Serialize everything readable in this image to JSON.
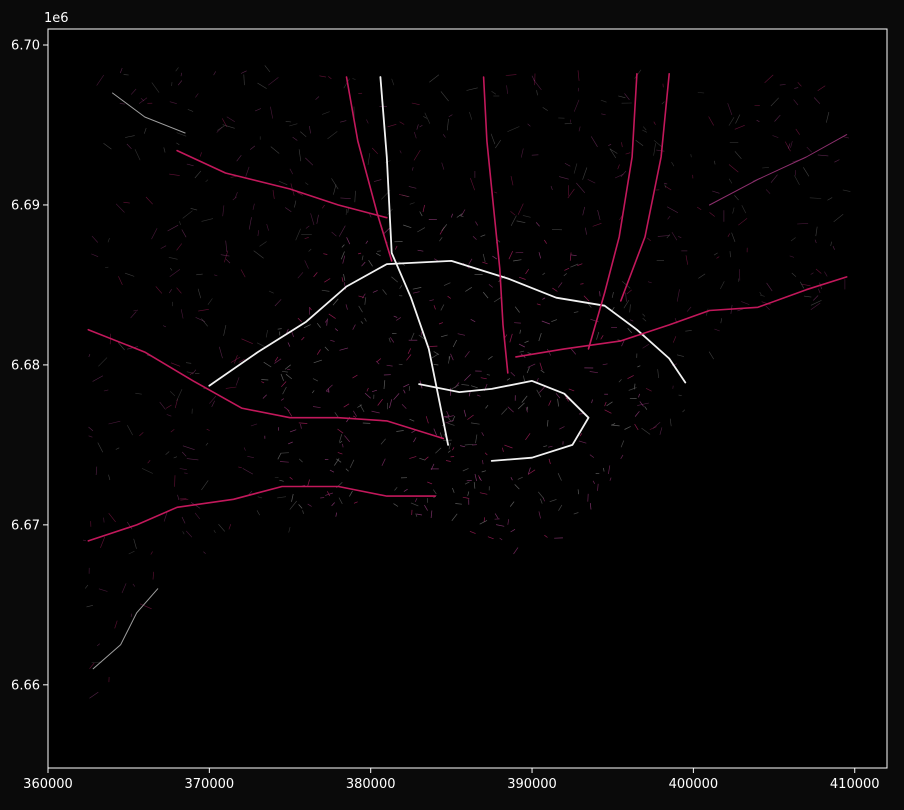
{
  "chart_data": {
    "type": "map",
    "title": "",
    "xlabel": "",
    "ylabel": "",
    "y_offset_label": "1e6",
    "xlim": [
      360000,
      412000
    ],
    "ylim": [
      6654800,
      6701000
    ],
    "x_ticks": [
      {
        "value": 360000,
        "label": "360000"
      },
      {
        "value": 370000,
        "label": "370000"
      },
      {
        "value": 380000,
        "label": "380000"
      },
      {
        "value": 390000,
        "label": "390000"
      },
      {
        "value": 400000,
        "label": "400000"
      },
      {
        "value": 410000,
        "label": "410000"
      }
    ],
    "y_ticks": [
      {
        "value": 6660000,
        "label": "6.66"
      },
      {
        "value": 6670000,
        "label": "6.67"
      },
      {
        "value": 6680000,
        "label": "6.68"
      },
      {
        "value": 6690000,
        "label": "6.69"
      },
      {
        "value": 6700000,
        "label": "6.70"
      }
    ],
    "grid": false,
    "colors": {
      "background": "#000000",
      "figure_background": "#0a0a0a",
      "axes_frame": "#ffffff",
      "road_high": "#c2185b",
      "road_mid": "#8e2f6e",
      "road_low": "#9e9e9e",
      "road_bright": "#f2f2f2"
    },
    "major_roads": [
      {
        "name": "",
        "color": "road_bright",
        "points": [
          [
            370000,
            6678700
          ],
          [
            373000,
            6680800
          ],
          [
            376000,
            6682700
          ],
          [
            378500,
            6684900
          ],
          [
            381000,
            6686300
          ],
          [
            385000,
            6686500
          ],
          [
            388500,
            6685400
          ],
          [
            391500,
            6684200
          ],
          [
            394500,
            6683700
          ],
          [
            396500,
            6682200
          ],
          [
            398500,
            6680400
          ],
          [
            399500,
            6678900
          ]
        ]
      },
      {
        "name": "",
        "color": "road_bright",
        "points": [
          [
            383000,
            6678800
          ],
          [
            385500,
            6678300
          ],
          [
            387500,
            6678500
          ],
          [
            390000,
            6679000
          ],
          [
            392000,
            6678200
          ],
          [
            393500,
            6676700
          ],
          [
            392500,
            6675000
          ],
          [
            390000,
            6674200
          ],
          [
            387500,
            6674000
          ]
        ]
      },
      {
        "name": "",
        "color": "road_bright",
        "points": [
          [
            380600,
            6698000
          ],
          [
            381000,
            6693000
          ],
          [
            381300,
            6687000
          ],
          [
            382500,
            6684200
          ],
          [
            383600,
            6681000
          ],
          [
            384200,
            6678000
          ],
          [
            384800,
            6675000
          ]
        ]
      },
      {
        "name": "",
        "color": "road_high",
        "points": [
          [
            362500,
            6682200
          ],
          [
            366000,
            6680800
          ],
          [
            369000,
            6679000
          ],
          [
            372000,
            6677300
          ],
          [
            375000,
            6676700
          ],
          [
            378000,
            6676700
          ],
          [
            381000,
            6676500
          ],
          [
            384500,
            6675400
          ]
        ]
      },
      {
        "name": "",
        "color": "road_high",
        "points": [
          [
            362500,
            6669000
          ],
          [
            365500,
            6670000
          ],
          [
            368000,
            6671100
          ],
          [
            371500,
            6671600
          ],
          [
            374500,
            6672400
          ],
          [
            378000,
            6672400
          ],
          [
            381000,
            6671800
          ],
          [
            384000,
            6671800
          ]
        ]
      },
      {
        "name": "",
        "color": "road_high",
        "points": [
          [
            389000,
            6680500
          ],
          [
            392000,
            6681000
          ],
          [
            395500,
            6681500
          ],
          [
            398500,
            6682500
          ],
          [
            401000,
            6683400
          ],
          [
            404000,
            6683600
          ],
          [
            407000,
            6684700
          ],
          [
            409500,
            6685500
          ]
        ]
      },
      {
        "name": "",
        "color": "road_high",
        "points": [
          [
            396500,
            6698200
          ],
          [
            396200,
            6693000
          ],
          [
            395400,
            6688000
          ],
          [
            394500,
            6684500
          ],
          [
            393500,
            6681000
          ]
        ]
      },
      {
        "name": "",
        "color": "road_high",
        "points": [
          [
            398500,
            6698200
          ],
          [
            398000,
            6693000
          ],
          [
            397000,
            6688000
          ],
          [
            395500,
            6684000
          ]
        ]
      },
      {
        "name": "",
        "color": "road_high",
        "points": [
          [
            387000,
            6698000
          ],
          [
            387200,
            6694000
          ],
          [
            387600,
            6690000
          ],
          [
            388000,
            6686000
          ],
          [
            388200,
            6682500
          ],
          [
            388500,
            6679500
          ]
        ]
      },
      {
        "name": "",
        "color": "road_high",
        "points": [
          [
            368000,
            6693400
          ],
          [
            371000,
            6692000
          ],
          [
            375000,
            6691000
          ],
          [
            378000,
            6690000
          ],
          [
            381000,
            6689200
          ]
        ]
      },
      {
        "name": "",
        "color": "road_high",
        "points": [
          [
            378500,
            6698000
          ],
          [
            379200,
            6694000
          ],
          [
            380400,
            6689500
          ],
          [
            381300,
            6686500
          ]
        ]
      },
      {
        "name": "",
        "color": "road_mid",
        "points": [
          [
            401000,
            6690000
          ],
          [
            404000,
            6691600
          ],
          [
            407000,
            6693000
          ],
          [
            409500,
            6694400
          ]
        ]
      },
      {
        "name": "",
        "color": "road_low",
        "points": [
          [
            364000,
            6697000
          ],
          [
            366000,
            6695500
          ],
          [
            368500,
            6694500
          ]
        ]
      },
      {
        "name": "",
        "color": "road_low",
        "points": [
          [
            362800,
            6661000
          ],
          [
            364500,
            6662500
          ],
          [
            365500,
            6664500
          ],
          [
            366800,
            6666000
          ]
        ]
      }
    ]
  }
}
